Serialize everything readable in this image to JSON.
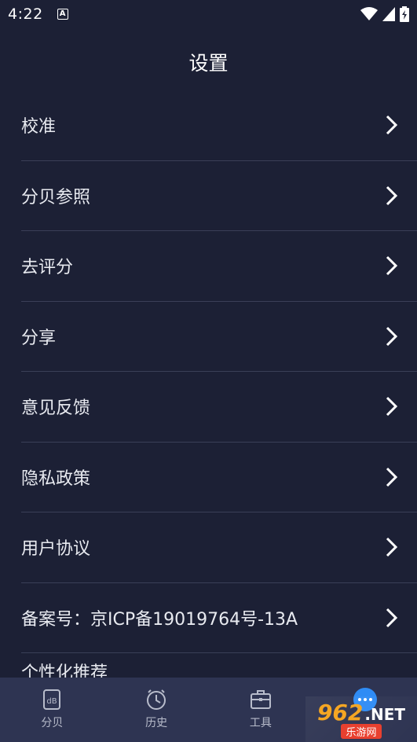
{
  "status_bar": {
    "time": "4:22",
    "notification_icon_letter": "A"
  },
  "header": {
    "title": "设置"
  },
  "settings": [
    {
      "label": "校准"
    },
    {
      "label": "分贝参照"
    },
    {
      "label": "去评分"
    },
    {
      "label": "分享"
    },
    {
      "label": "意见反馈"
    },
    {
      "label": "隐私政策"
    },
    {
      "label": "用户协议"
    },
    {
      "label": "备案号：京ICP备19019764号-13A"
    }
  ],
  "partial_item": {
    "label": "个性化推荐"
  },
  "tab_bar": {
    "tabs": [
      {
        "label": "分贝",
        "icon": "db-meter-icon"
      },
      {
        "label": "历史",
        "icon": "history-clock-icon"
      },
      {
        "label": "工具",
        "icon": "toolbox-icon"
      },
      {
        "label": "",
        "icon": "more-icon"
      }
    ]
  },
  "watermark": {
    "number": "962",
    "suffix": ".NET",
    "subtitle": "乐游网"
  },
  "colors": {
    "background": "#1c2035",
    "tab_bar": "#2e3452",
    "divider": "#3a3f57",
    "accent": "#2f8cf5"
  }
}
